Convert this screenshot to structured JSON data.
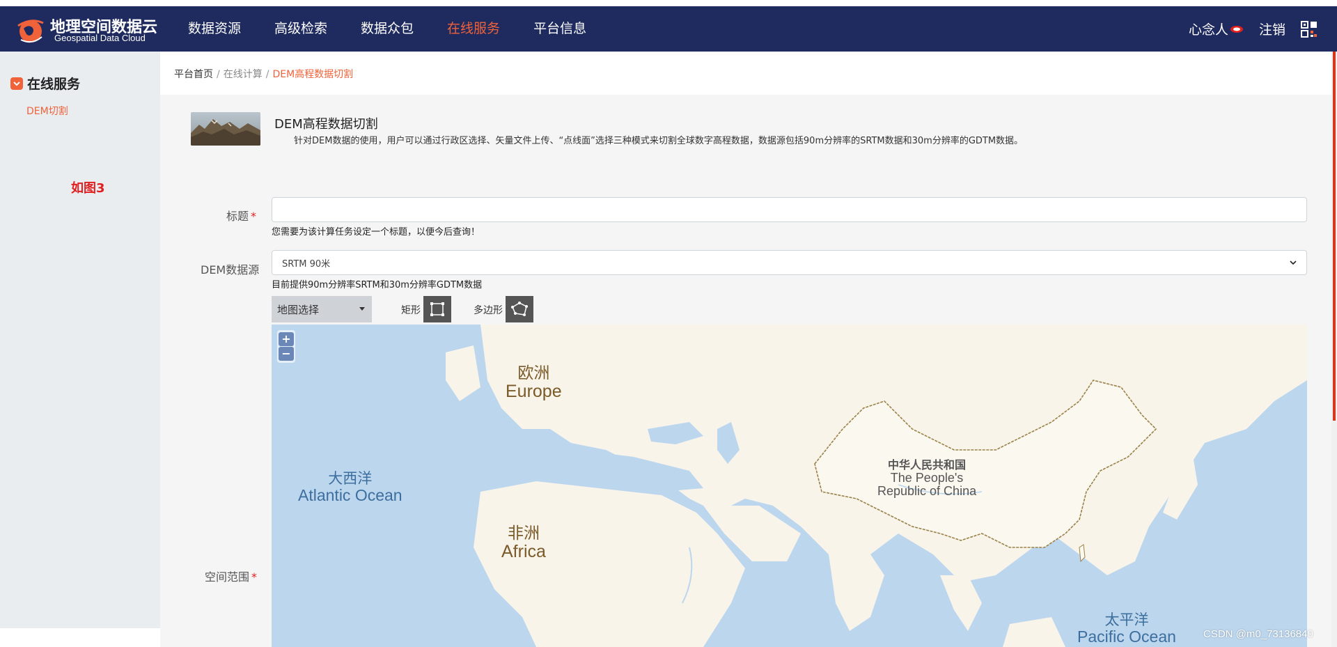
{
  "header": {
    "logo_cn": "地理空间数据云",
    "logo_en": "Geospatial Data Cloud",
    "nav": [
      {
        "label": "数据资源"
      },
      {
        "label": "高级检索"
      },
      {
        "label": "数据众包"
      },
      {
        "label": "在线服务",
        "active": true
      },
      {
        "label": "平台信息"
      }
    ],
    "user_name": "心念人",
    "logout_label": "注销"
  },
  "sidebar": {
    "title": "在线服务",
    "sub_item": "DEM切割",
    "note": "如图3"
  },
  "breadcrumb": {
    "home": "平台首页",
    "sep": "/",
    "middle": "在线计算",
    "current": "DEM高程数据切割"
  },
  "service": {
    "title": "DEM高程数据切割",
    "description": "针对DEM数据的使用，用户可以通过行政区选择、矢量文件上传、“点线面”选择三种模式来切割全球数字高程数据，数据源包括90m分辨率的SRTM数据和30m分辨率的GDTM数据。"
  },
  "form": {
    "title_label": "标题",
    "title_value": "",
    "title_hint": "您需要为该计算任务设定一个标题，以便今后查询！",
    "dem_label": "DEM数据源",
    "dem_value": "SRTM 90米",
    "dem_hint": "目前提供90m分辨率SRTM和30m分辨率GDTM数据",
    "required_mark": "*",
    "map_mode": "地图选择",
    "rect_label": "矩形",
    "polygon_label": "多边形",
    "extent_label": "空间范围"
  },
  "map": {
    "zoom_in": "+",
    "zoom_out": "−",
    "labels": {
      "europe_cn": "欧洲",
      "europe_en": "Europe",
      "atlantic_cn": "大西洋",
      "atlantic_en": "Atlantic Ocean",
      "africa_cn": "非洲",
      "africa_en": "Africa",
      "china_cn": "中华人民共和国",
      "china_en_1": "The People's",
      "china_en_2": "Republic of China",
      "pacific_cn": "太平洋",
      "pacific_en": "Pacific Ocean"
    },
    "colors": {
      "water": "#bcd6ee",
      "land": "#f8f4ea",
      "border": "#9a8148"
    }
  },
  "watermark": "CSDN @m0_73136840",
  "colors": {
    "header_bg": "#1f2b5e",
    "accent": "#f0623a",
    "required": "#e02020"
  }
}
